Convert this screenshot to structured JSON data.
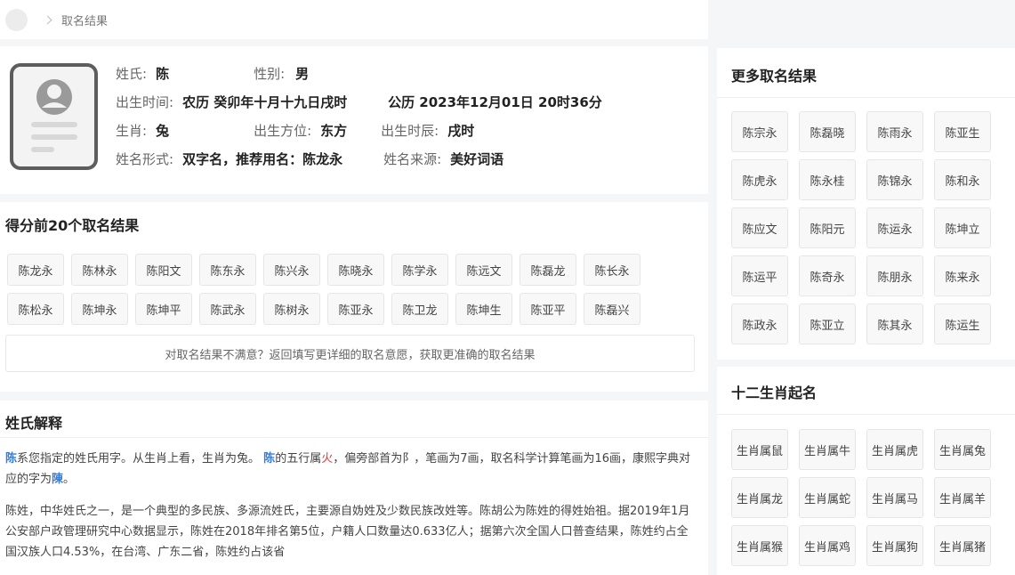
{
  "breadcrumb": {
    "current": "取名结果"
  },
  "info": {
    "surname_label": "姓氏:",
    "surname": "陈",
    "gender_label": "性别:",
    "gender": "男",
    "birth_time_label": "出生时间:",
    "lunar": "农历 癸卯年十月十九日戌时",
    "solar": "公历 2023年12月01日 20时36分",
    "zodiac_label": "生肖:",
    "zodiac": "兔",
    "direction_label": "出生方位:",
    "direction": "东方",
    "hour_label": "出生时辰:",
    "hour": "戌时",
    "form_label": "姓名形式:",
    "form": "双字名，推荐用名：陈龙永",
    "source_label": "姓名来源:",
    "source": "美好词语"
  },
  "top20": {
    "title": "得分前20个取名结果",
    "names": [
      "陈龙永",
      "陈林永",
      "陈阳文",
      "陈东永",
      "陈兴永",
      "陈晓永",
      "陈学永",
      "陈远文",
      "陈磊龙",
      "陈长永",
      "陈松永",
      "陈坤永",
      "陈坤平",
      "陈武永",
      "陈树永",
      "陈亚永",
      "陈卫龙",
      "陈坤生",
      "陈亚平",
      "陈磊兴"
    ],
    "notice": "对取名结果不满意？返回填写更详细的取名意愿，获取更准确的取名结果"
  },
  "surname_explain": {
    "title": "姓氏解释",
    "p1": {
      "char1": "陈",
      "t1": "系您指定的姓氏用字。从生肖上看，生肖为兔。",
      "char2": "陈",
      "t2": "的五行属",
      "element": "火",
      "t3": "，偏旁部首为阝，笔画为7画，取名科学计算笔画为16画，康熙字典对应的字为",
      "char3": "陳",
      "t4": "。"
    },
    "p2": "陈姓，中华姓氏之一，是一个典型的多民族、多源流姓氏，主要源自妫姓及少数民族改姓等。陈胡公为陈姓的得姓始祖。据2019年1月公安部户政管理研究中心数据显示，陈姓在2018年排名第5位，户籍人口数量达0.633亿人；据第六次全国人口普查结果，陈姓约占全国汉族人口4.53%，在台湾、广东二省，陈姓约占该省"
  },
  "more": {
    "title": "更多取名结果",
    "names": [
      "陈宗永",
      "陈磊晓",
      "陈雨永",
      "陈亚生",
      "陈虎永",
      "陈永桂",
      "陈锦永",
      "陈和永",
      "陈应文",
      "陈阳元",
      "陈运永",
      "陈坤立",
      "陈运平",
      "陈奇永",
      "陈朋永",
      "陈来永",
      "陈政永",
      "陈亚立",
      "陈其永",
      "陈运生"
    ]
  },
  "zodiac_naming": {
    "title": "十二生肖起名",
    "items": [
      "生肖属鼠",
      "生肖属牛",
      "生肖属虎",
      "生肖属兔",
      "生肖属龙",
      "生肖属蛇",
      "生肖属马",
      "生肖属羊",
      "生肖属猴",
      "生肖属鸡",
      "生肖属狗",
      "生肖属猪"
    ]
  },
  "colors": {
    "accent": "#3a7bd5",
    "fire": "#e4393c"
  }
}
